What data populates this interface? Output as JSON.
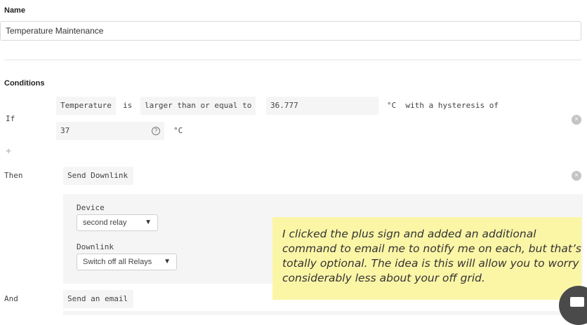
{
  "name_section": {
    "label": "Name",
    "value": "Temperature Maintenance"
  },
  "conditions": {
    "heading": "Conditions",
    "if_label": "If",
    "field": "Temperature",
    "verb": "is",
    "operator": "larger than or equal to",
    "threshold": "36.777",
    "unit_text": "°C  with a hysteresis of",
    "hysteresis_value": "37",
    "help_glyph": "?",
    "hysteresis_unit": "°C",
    "add_glyph": "+",
    "remove_glyph": "×"
  },
  "then_action": {
    "label": "Then",
    "action": "Send Downlink",
    "device_label": "Device",
    "device_value": "second relay",
    "downlink_label": "Downlink",
    "downlink_value": "Switch off all Relays",
    "remove_glyph": "×"
  },
  "and_action": {
    "label": "And",
    "action": "Send an email"
  },
  "annotation": {
    "text": "I clicked the plus sign and added an additional command to email me to notify me on each, but that’s totally optional. The idea is this will allow you to worry considerably less about your off grid."
  },
  "icons": {
    "help": "help-circle-icon",
    "remove": "close-circle-icon",
    "chevron": "chevron-down-icon",
    "chat": "chat-icon"
  },
  "colors": {
    "note_background": "#fbf6a6",
    "chip_background": "#f5f5f5"
  }
}
